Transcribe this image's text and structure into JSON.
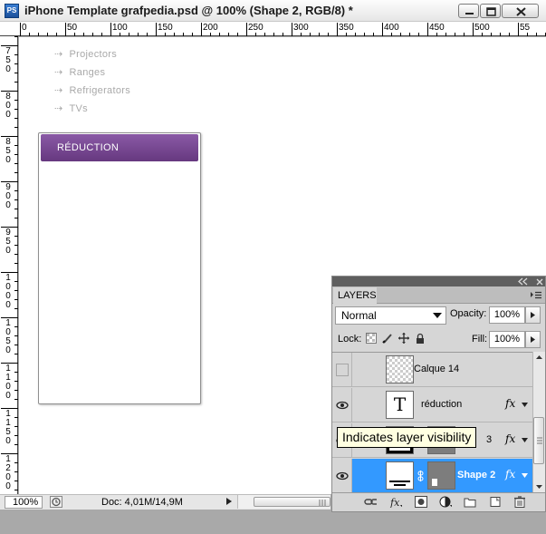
{
  "window": {
    "app_icon": "PS",
    "title": "iPhone Template grafpedia.psd @ 100% (Shape 2, RGB/8) *",
    "controls": [
      "minimize-icon",
      "maximize-icon",
      "close-icon"
    ]
  },
  "rulers": {
    "horizontal_labels": [
      "0",
      "50",
      "100",
      "150",
      "200",
      "250",
      "300",
      "350",
      "400",
      "450",
      "500",
      "55"
    ],
    "vertical_labels": [
      "750",
      "800",
      "850",
      "900",
      "950",
      "1000",
      "1050",
      "1100",
      "1150",
      "1200"
    ]
  },
  "canvas": {
    "nav_items": [
      "Projectors",
      "Ranges",
      "Refrigerators",
      "TVs"
    ],
    "nav_arrow": "⇢",
    "card_title": "RÉDUCTION",
    "colors": {
      "card_header": "#7a4d96",
      "nav_text": "#a9a9a9"
    }
  },
  "statusbar": {
    "zoom": "100%",
    "doc_info": "Doc: 4,01M/14,9M"
  },
  "layers_panel": {
    "tab_label": "LAYERS",
    "blend_mode": "Normal",
    "opacity_label": "Opacity:",
    "opacity_value": "100%",
    "lock_label": "Lock:",
    "fill_label": "Fill:",
    "fill_value": "100%",
    "layers": [
      {
        "name": "Calque 14",
        "visible": false,
        "type": "raster",
        "fx": false
      },
      {
        "name": "réduction",
        "visible": true,
        "type": "text",
        "thumb_glyph": "T",
        "fx": true
      },
      {
        "name": "3",
        "visible": true,
        "type": "shape",
        "fx": true
      },
      {
        "name": "Shape 2",
        "visible": true,
        "type": "shape",
        "fx": true,
        "selected": true
      }
    ],
    "fx_label": "fx",
    "bottom_icons": [
      "link-icon",
      "fx-icon",
      "mask-icon",
      "adjustment-icon",
      "folder-icon",
      "new-layer-icon",
      "trash-icon"
    ],
    "selected_color": "#3399ff"
  },
  "tooltip": {
    "text": "Indicates layer visibility"
  }
}
